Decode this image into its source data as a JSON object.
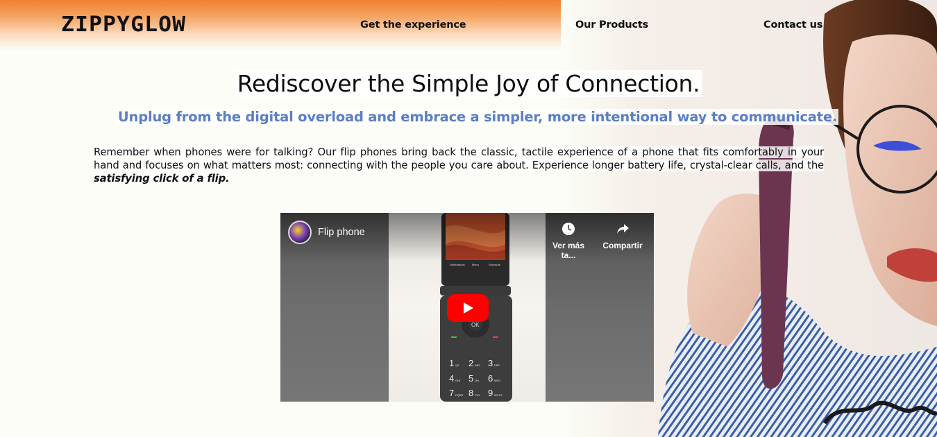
{
  "header": {
    "logo": "ZIPPYGLOW",
    "nav": [
      {
        "label": "Get the experience"
      },
      {
        "label": "Our Products"
      },
      {
        "label": "Contact us"
      }
    ]
  },
  "hero": {
    "headline": "Rediscover the Simple Joy of Connection.",
    "subheadline": "Unplug from the digital overload and embrace a simpler, more intentional way to communicate.",
    "body_plain": "Remember when phones were for talking? Our flip phones bring back the classic, tactile experience of a phone that fits comfortably in your hand and focuses on what matters most: connecting with the people you care about. Experience longer battery life, crystal-clear calls, and the ",
    "body_emphasis": "satisfying click of a flip."
  },
  "video": {
    "title": "Flip phone",
    "watch_later_label": "Ver más ta...",
    "share_label": "Compartir",
    "phone_keys": [
      "1",
      "2",
      "3",
      "4",
      "5",
      "6",
      "7",
      "8",
      "9"
    ],
    "phone_key_sub": [
      "QZ",
      "ABC",
      "DEF",
      "GHI",
      "JKL",
      "MNO",
      "PQRS",
      "TUV",
      "WXYZ"
    ],
    "ok_label": "OK",
    "screen_labels": [
      "Notifications",
      "Menu",
      "Shortcuts"
    ]
  },
  "colors": {
    "accent_orange": "#f07f2e",
    "subhead_blue": "#5b7fc4",
    "play_red": "#ff0000"
  }
}
